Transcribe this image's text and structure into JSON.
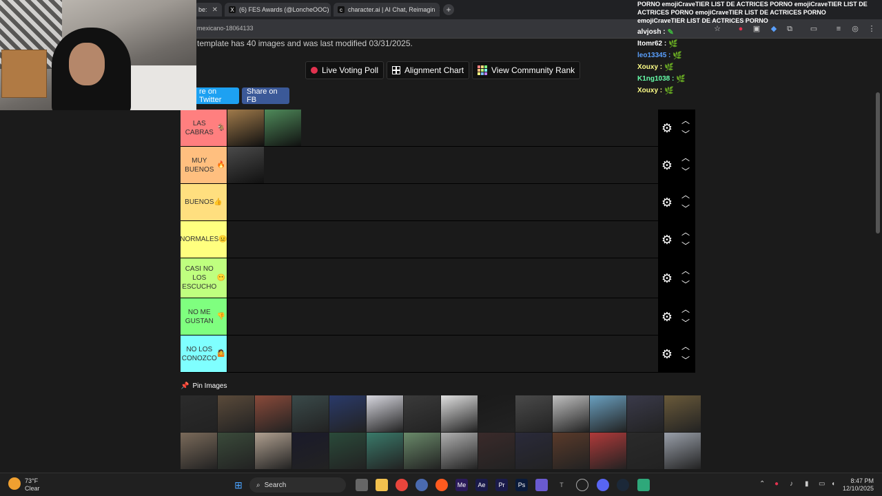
{
  "browser": {
    "tabs": [
      {
        "label": "be:",
        "icon": "tab-icon"
      },
      {
        "label": "(6) FES Awards (@LoncheOOC)",
        "icon": "x-icon"
      },
      {
        "label": "character.ai | AI Chat, Reimagin",
        "icon": "cai-icon"
      }
    ],
    "url": "mexicano-18064133"
  },
  "page": {
    "description": "template has 40 images and was last modified 03/31/2025.",
    "buttons": {
      "live_voting": "Live Voting Poll",
      "alignment": "Alignment Chart",
      "community_rank": "View Community Rank"
    },
    "share": {
      "twitter": "re on Twitter",
      "fb": "Share on FB"
    }
  },
  "tiers": [
    {
      "label": "LAS CABRAS",
      "emoji": "🐐",
      "color": "#ff7f7f",
      "items": [
        "#a07a4a",
        "#4f8a5a"
      ]
    },
    {
      "label": "MUY BUENOS",
      "emoji": "🔥",
      "color": "#ffbf7f",
      "items": [
        "#4a4a4a"
      ]
    },
    {
      "label": "BUENOS",
      "emoji": "👍",
      "color": "#ffdf7f",
      "items": []
    },
    {
      "label": "NORMALES",
      "emoji": "😐",
      "color": "#ffff7f",
      "items": []
    },
    {
      "label": "CASI NO LOS ESCUCHO",
      "emoji": "😶",
      "color": "#bfff7f",
      "items": []
    },
    {
      "label": "NO ME GUSTAN",
      "emoji": "👎",
      "color": "#7fff7f",
      "items": []
    },
    {
      "label": "NO LOS CONOZCO",
      "emoji": "🤷",
      "color": "#7fffff",
      "items": []
    }
  ],
  "pool": {
    "title": "Pin Images",
    "items": [
      "#2b2b2b",
      "#5a4a3a",
      "#8a4a3a",
      "#3a4a4a",
      "#2a3a6a",
      "#d8d8e0",
      "#3a3a3a",
      "#e0e0e0",
      "#1a1a1a",
      "#4a4a4a",
      "#c0c0c0",
      "#6aa0c0",
      "#3a3a4a",
      "#6a5a3a",
      "#7a6a5a",
      "#3a4a3a",
      "#b0a090",
      "#1a1a2a",
      "#2a4a3a",
      "#3a7a6a",
      "#6a8a6a",
      "#b0b0b0",
      "#3a2a2a",
      "#2a2a3a",
      "#5a3a2a",
      "#b03a3a",
      "#2a2a2a",
      "#9aa0aa"
    ]
  },
  "chat": {
    "header_msg": "PORNO emojiCraveTIER LIST DE ACTRICES PORNO emojiCraveTIER LIST DE ACTRICES PORNO emojiCraveTIER LIST DE ACTRICES PORNO emojiCraveTIER LIST DE ACTRICES PORNO",
    "messages": [
      {
        "user": "alvjosh :",
        "color": "#ffffff",
        "emote": "✎"
      },
      {
        "user": "Itomr62 :",
        "color": "#ffffff",
        "emote": "🌿"
      },
      {
        "user": "leo13345 :",
        "color": "#5aa0ff",
        "emote": "🌿"
      },
      {
        "user": "Xouxy :",
        "color": "#ffff88",
        "emote": "🌿"
      },
      {
        "user": "K1ng1038 :",
        "color": "#66ffaa",
        "emote": "🌿"
      },
      {
        "user": "Xouxy :",
        "color": "#ffff88",
        "emote": "🌿"
      }
    ]
  },
  "taskbar": {
    "temp": "73°F",
    "condition": "Clear",
    "search": "Search",
    "time": "8:47 PM",
    "date": "12/10/2025"
  }
}
